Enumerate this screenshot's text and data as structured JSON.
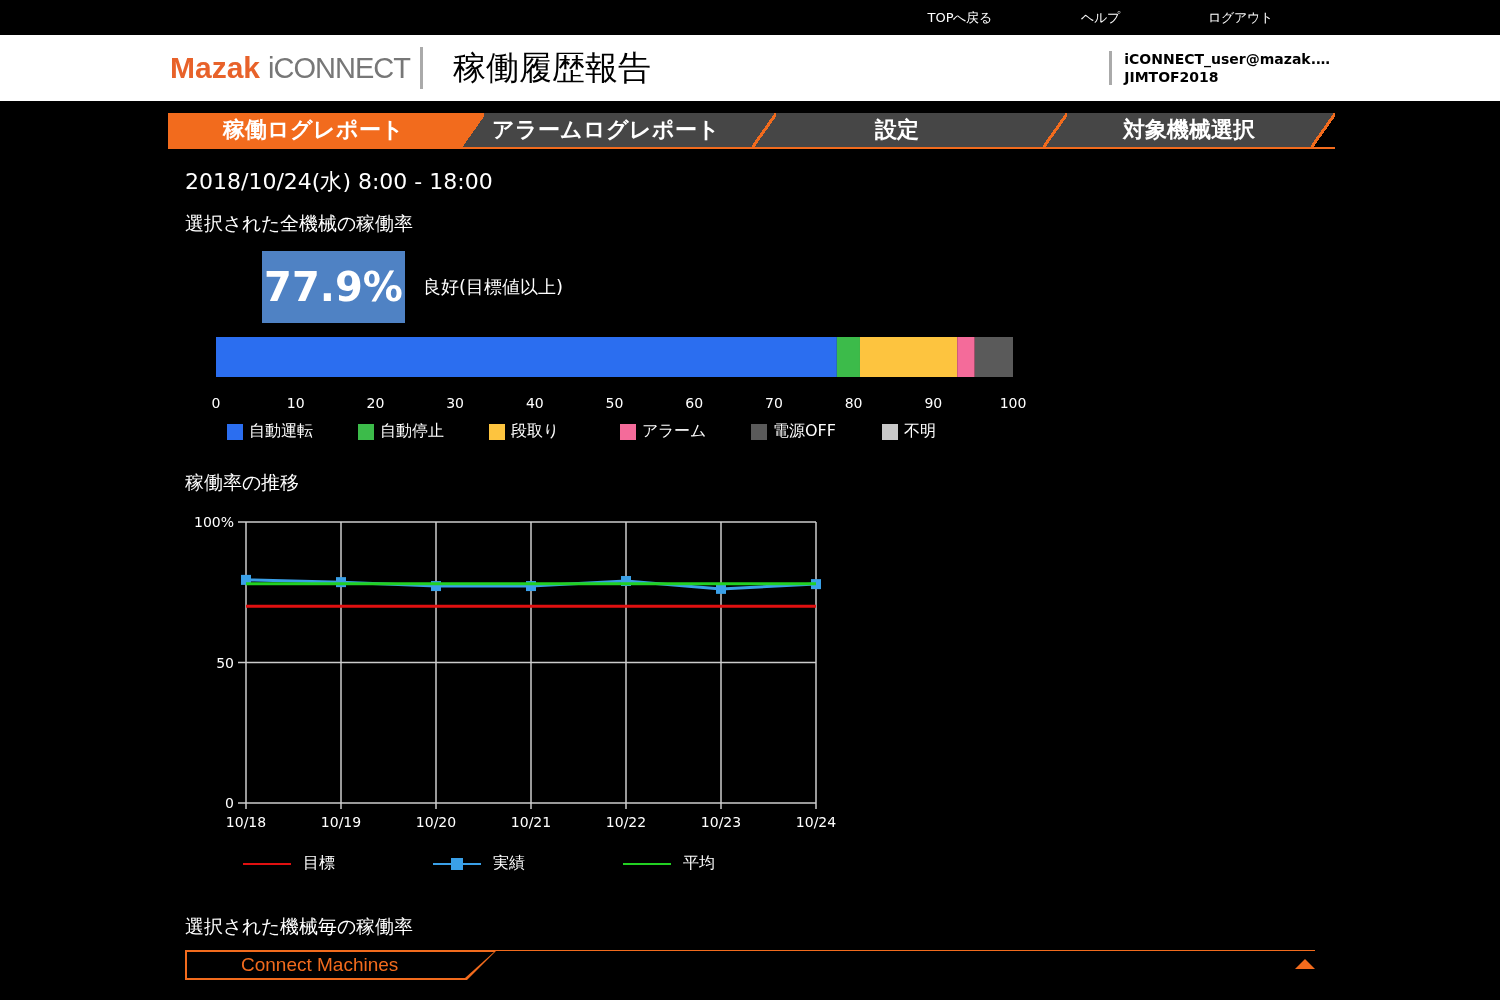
{
  "top_links": [
    "TOPへ戻る",
    "ヘルプ",
    "ログアウト"
  ],
  "header": {
    "logo_brand": "Mazak",
    "logo_product": "iCONNECT",
    "title": "稼働履歴報告",
    "user": "iCONNECT_user@mazak.…",
    "account": "JIMTOF2018"
  },
  "tabs": [
    {
      "label": "稼働ログレポート",
      "selected": true
    },
    {
      "label": "アラームログレポート",
      "selected": false
    },
    {
      "label": "設定",
      "selected": false
    },
    {
      "label": "対象機械選択",
      "selected": false
    }
  ],
  "period": "2018/10/24(水) 8:00 - 18:00",
  "overall": {
    "heading": "選択された全機械の稼働率",
    "rate": "77.9%",
    "evaluation": "良好(目標値以上)",
    "chart_data": {
      "type": "bar",
      "orientation": "horizontal",
      "stacked": true,
      "xlim": [
        0,
        100
      ],
      "xticks": [
        0,
        10,
        20,
        30,
        40,
        50,
        60,
        70,
        80,
        90,
        100
      ],
      "series": [
        {
          "name": "自動運転",
          "color": "#2b6ef0",
          "values": [
            77.9
          ]
        },
        {
          "name": "自動停止",
          "color": "#3cbb4a",
          "values": [
            2.9
          ]
        },
        {
          "name": "段取り",
          "color": "#fdc43f",
          "values": [
            12.2
          ]
        },
        {
          "name": "アラーム",
          "color": "#f46b9a",
          "values": [
            2.2
          ]
        },
        {
          "name": "電源OFF",
          "color": "#5a5a5a",
          "values": [
            4.8
          ]
        },
        {
          "name": "不明",
          "color": "#c8c8c8",
          "values": [
            0
          ]
        }
      ]
    }
  },
  "trend": {
    "heading": "稼働率の推移",
    "chart_data": {
      "type": "line",
      "grid": true,
      "x": [
        "10/18",
        "10/19",
        "10/20",
        "10/21",
        "10/22",
        "10/23",
        "10/24"
      ],
      "ylim": [
        0,
        100
      ],
      "yticks": [
        0,
        50,
        {
          "value": 100,
          "label": "100%"
        }
      ],
      "series": [
        {
          "name": "目標",
          "color": "#e01010",
          "values": [
            70,
            70,
            70,
            70,
            70,
            70,
            70
          ]
        },
        {
          "name": "実績",
          "color": "#3aa0e8",
          "marker": "square",
          "values": [
            79.4,
            78.6,
            77.2,
            77.2,
            79,
            76.2,
            77.9
          ]
        },
        {
          "name": "平均",
          "color": "#22d022",
          "values": [
            78,
            78,
            78,
            78,
            78,
            78,
            78
          ]
        }
      ]
    }
  },
  "machines": {
    "heading": "選択された機械毎の稼働率",
    "group_label": "Connect Machines",
    "expanded": true
  }
}
